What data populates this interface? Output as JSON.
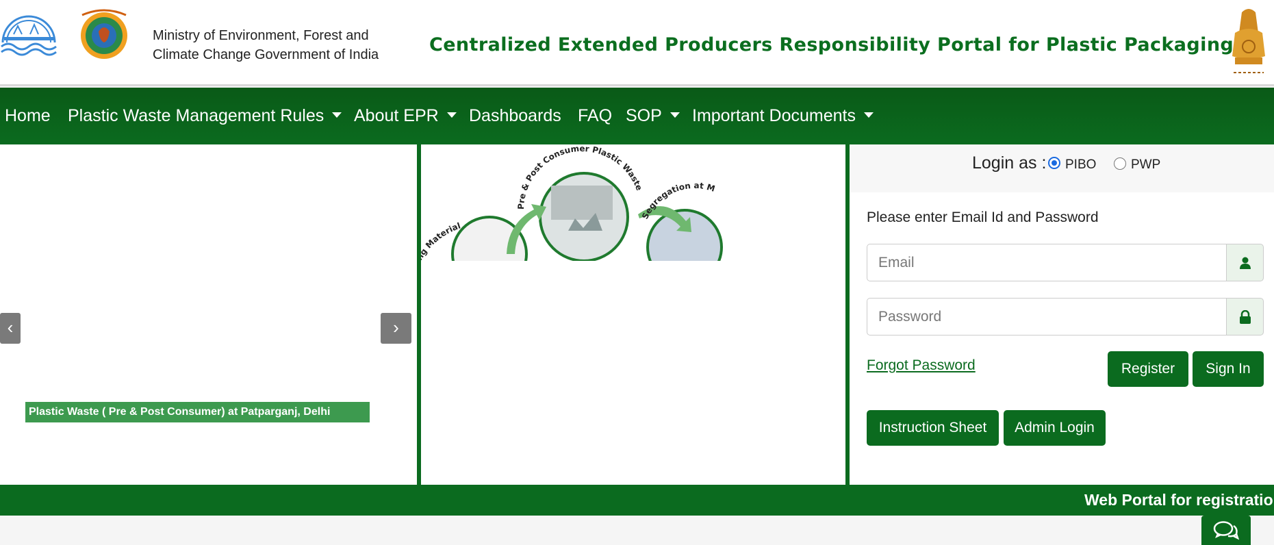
{
  "header": {
    "ministry_line1": "Ministry of Environment, Forest and",
    "ministry_line2": "Climate Change Government of India",
    "portal_title": "Centralized Extended Producers Responsibility Portal for Plastic Packaging"
  },
  "nav": {
    "items": [
      {
        "label": "Home",
        "dropdown": false
      },
      {
        "label": "Plastic Waste Management Rules",
        "dropdown": true
      },
      {
        "label": "About EPR",
        "dropdown": true
      },
      {
        "label": "Dashboards",
        "dropdown": false
      },
      {
        "label": "FAQ",
        "dropdown": false
      },
      {
        "label": "SOP",
        "dropdown": true
      },
      {
        "label": "Important Documents",
        "dropdown": true
      }
    ]
  },
  "carousel": {
    "prev": "‹",
    "next": "›",
    "caption": "Plastic Waste ( Pre & Post Consumer) at Patparganj, Delhi"
  },
  "diagram": {
    "labels": [
      "Pre & Post Consumer Plastic Waste",
      "Segregation at M",
      "ng Material"
    ]
  },
  "login": {
    "login_as_label": "Login as :",
    "options": [
      "PIBO",
      "PWP"
    ],
    "selected": "PIBO",
    "hint": "Please enter Email Id and Password",
    "email_placeholder": "Email",
    "password_placeholder": "Password",
    "forgot_password": "Forgot Password",
    "register": "Register",
    "sign_in": "Sign In",
    "instruction_sheet": "Instruction Sheet",
    "admin_login": "Admin Login"
  },
  "marquee": {
    "text": "Web Portal for registratio"
  },
  "colors": {
    "brand_green": "#0b6b1f",
    "caption_green": "#3d9a4f",
    "radio_blue": "#1a6ae0"
  },
  "icons": [
    "user-icon",
    "lock-icon",
    "chat-icon",
    "chevron-left-icon",
    "chevron-right-icon",
    "caret-down-icon"
  ]
}
